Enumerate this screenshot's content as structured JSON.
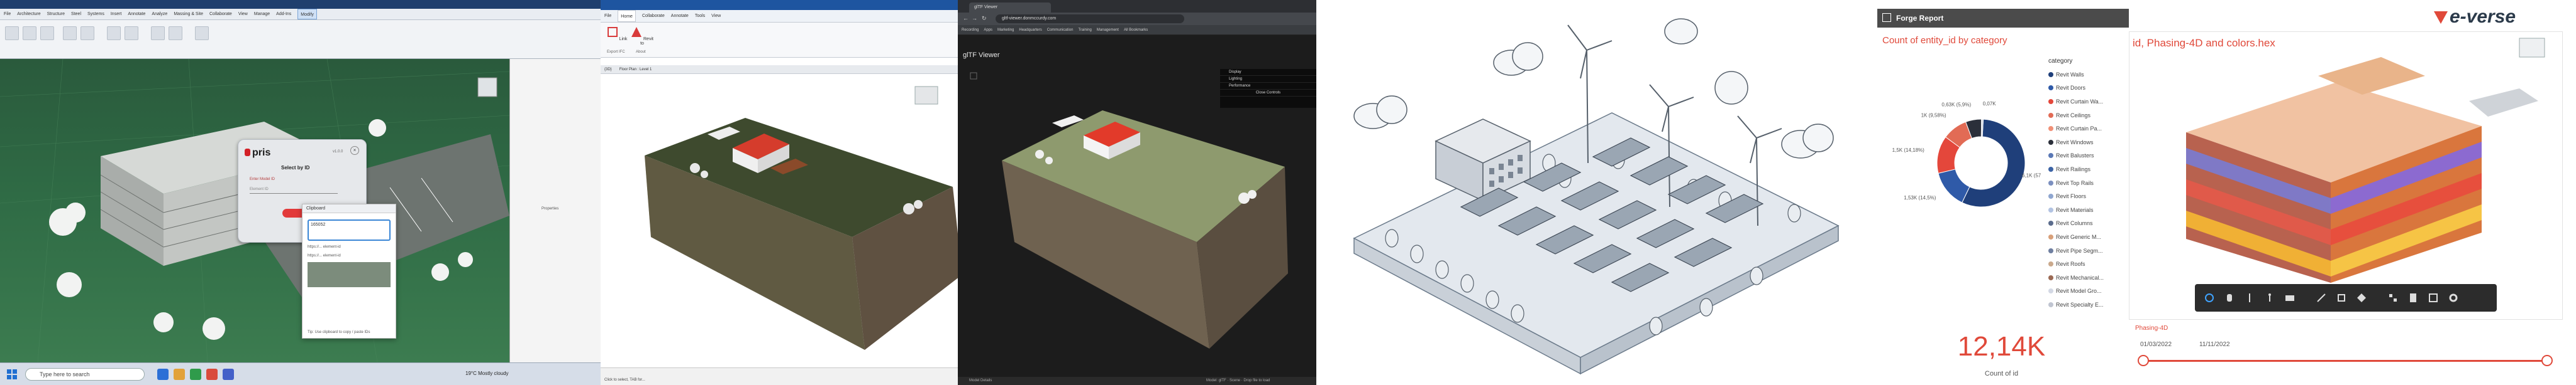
{
  "panel1": {
    "title_bar": "",
    "ribbon_tabs": [
      "File",
      "Architecture",
      "Structure",
      "Steel",
      "Systems",
      "Insert",
      "Annotate",
      "Analyze",
      "Massing & Site",
      "Collaborate",
      "View",
      "Manage",
      "Add-Ins",
      "Modify"
    ],
    "pris": {
      "brand": "pris",
      "version": "v1.0.0",
      "heading": "Select by ID",
      "field_label": "Enter Model ID",
      "field_placeholder": "Element ID"
    },
    "dropdown": {
      "header": "Clipboard",
      "field_value": "165052",
      "item1": "https://... element-id",
      "item2": "https://... element-id",
      "footer": "Tip: Use clipboard to copy / paste IDs"
    },
    "rightpane_msg": "Properties",
    "taskbar": {
      "search_placeholder": "Type here to search",
      "tray": "19°C  Mostly cloudy",
      "clock_time": "",
      "clock_date": ""
    }
  },
  "panel2": {
    "title_bar": "",
    "ribbon_tabs": [
      "File",
      "Home",
      "Collaborate",
      "Annotate",
      "Tools",
      "View"
    ],
    "tools": [
      {
        "label": "Link"
      },
      {
        "label": "Revit to"
      }
    ],
    "group_labels": [
      "Export IFC",
      "About"
    ],
    "view_tabs": [
      "{3D}",
      "Floor Plan : Level 1"
    ],
    "status_line1": "",
    "status_line2": "Click to select, TAB for..."
  },
  "panel3": {
    "browser_tab": "glTF Viewer",
    "url": "gltf-viewer.donmccurdy.com",
    "bookmarks": [
      "Recording",
      "Apps",
      "Marketing",
      "Headquarters",
      "Communication",
      "Training",
      "Management",
      "All Bookmarks"
    ],
    "viewer_title": "glTF Viewer",
    "menu_items": [
      "Display",
      "Lighting",
      "Performance",
      "Close Controls"
    ],
    "status_left": "Model Details",
    "status_right": "Model: glTF · Scene · Drop file to load"
  },
  "panel5": {
    "report_title": "Forge Report",
    "chart_title": "Count of entity_id by category",
    "legend_title": "category",
    "brand": "e-verse",
    "model_title": "id, Phasing-4D and colors.hex",
    "kpi_value": "12,14K",
    "kpi_label": "Count of id",
    "filter_label": "Phasing-4D",
    "date_start": "01/03/2022",
    "date_end": "11/11/2022",
    "colors": {
      "accent": "#e0493a",
      "header": "#4b4b4b"
    }
  },
  "chart_data": {
    "type": "pie",
    "title": "Count of entity_id by category",
    "legend_title": "category",
    "categories": [
      "Revit Walls",
      "Revit Doors",
      "Revit Curtain Wa...",
      "Revit Ceilings",
      "Revit Curtain Pa...",
      "Revit Windows",
      "Revit Balusters",
      "Revit Railings",
      "Revit Top Rails",
      "Revit Floors",
      "Revit Materials",
      "Revit Columns",
      "Revit Generic M...",
      "Revit Pipe Segm...",
      "Revit Roofs",
      "Revit Mechanical...",
      "Revit Model Gro...",
      "Revit Specialty E..."
    ],
    "colors": [
      "#1f3f7a",
      "#2f5aa8",
      "#e4473b",
      "#e26b55",
      "#f09077",
      "#2b2f3a",
      "#5a78b5",
      "#3c63a5",
      "#7b8fbf",
      "#8fa6d0",
      "#b2c3e2",
      "#5b6c8c",
      "#d8a07a",
      "#6f7fa0",
      "#caa98c",
      "#9b6a55",
      "#d3d8e4",
      "#c0c5d1"
    ],
    "slices": [
      {
        "label": "6,1K (57%)",
        "value": 6100
      },
      {
        "label": "1,53K (14,5%)",
        "value": 1530
      },
      {
        "label": "1,5K (14,18%)",
        "value": 1500
      },
      {
        "label": "1K (9,58%)",
        "value": 1000
      },
      {
        "label": "0,63K (5,9%)",
        "value": 630
      },
      {
        "label": "0,07K",
        "value": 70
      }
    ],
    "callouts": [
      "6,1K (57%)",
      "1,53K (14,5%)",
      "1,5K (14,18%)",
      "1K (9,58%)",
      "0,63K (5,9%)",
      "0,07K"
    ]
  }
}
